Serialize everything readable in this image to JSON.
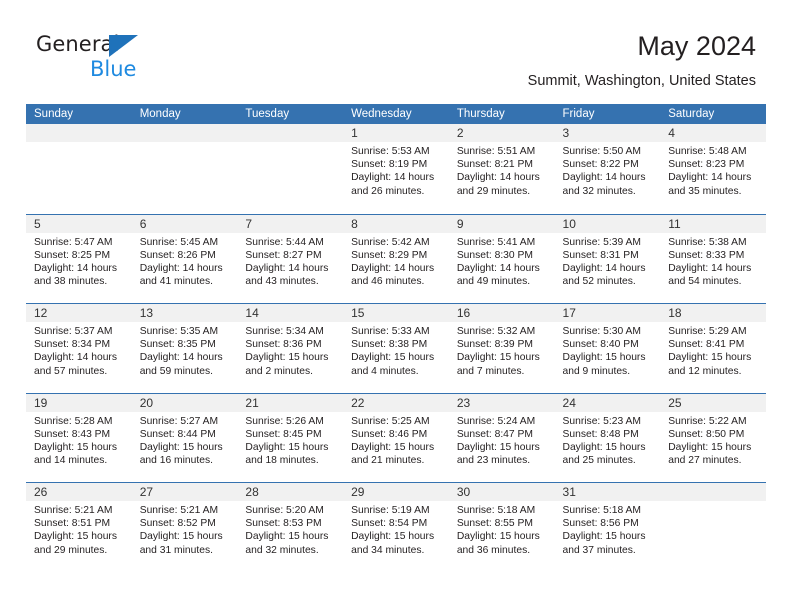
{
  "brand": {
    "name_part1": "General",
    "name_part2": "Blue",
    "accent_color": "#1f8ae0",
    "triangle_color": "#1f72ba"
  },
  "header": {
    "title": "May 2024",
    "subtitle": "Summit, Washington, United States"
  },
  "calendar": {
    "header_bg": "#3572b0",
    "day_band_bg": "#f1f1f1",
    "weekdays": [
      "Sunday",
      "Monday",
      "Tuesday",
      "Wednesday",
      "Thursday",
      "Friday",
      "Saturday"
    ],
    "weeks": [
      [
        {
          "day": "",
          "lines": []
        },
        {
          "day": "",
          "lines": []
        },
        {
          "day": "",
          "lines": []
        },
        {
          "day": "1",
          "lines": [
            "Sunrise: 5:53 AM",
            "Sunset: 8:19 PM",
            "Daylight: 14 hours",
            "and 26 minutes."
          ]
        },
        {
          "day": "2",
          "lines": [
            "Sunrise: 5:51 AM",
            "Sunset: 8:21 PM",
            "Daylight: 14 hours",
            "and 29 minutes."
          ]
        },
        {
          "day": "3",
          "lines": [
            "Sunrise: 5:50 AM",
            "Sunset: 8:22 PM",
            "Daylight: 14 hours",
            "and 32 minutes."
          ]
        },
        {
          "day": "4",
          "lines": [
            "Sunrise: 5:48 AM",
            "Sunset: 8:23 PM",
            "Daylight: 14 hours",
            "and 35 minutes."
          ]
        }
      ],
      [
        {
          "day": "5",
          "lines": [
            "Sunrise: 5:47 AM",
            "Sunset: 8:25 PM",
            "Daylight: 14 hours",
            "and 38 minutes."
          ]
        },
        {
          "day": "6",
          "lines": [
            "Sunrise: 5:45 AM",
            "Sunset: 8:26 PM",
            "Daylight: 14 hours",
            "and 41 minutes."
          ]
        },
        {
          "day": "7",
          "lines": [
            "Sunrise: 5:44 AM",
            "Sunset: 8:27 PM",
            "Daylight: 14 hours",
            "and 43 minutes."
          ]
        },
        {
          "day": "8",
          "lines": [
            "Sunrise: 5:42 AM",
            "Sunset: 8:29 PM",
            "Daylight: 14 hours",
            "and 46 minutes."
          ]
        },
        {
          "day": "9",
          "lines": [
            "Sunrise: 5:41 AM",
            "Sunset: 8:30 PM",
            "Daylight: 14 hours",
            "and 49 minutes."
          ]
        },
        {
          "day": "10",
          "lines": [
            "Sunrise: 5:39 AM",
            "Sunset: 8:31 PM",
            "Daylight: 14 hours",
            "and 52 minutes."
          ]
        },
        {
          "day": "11",
          "lines": [
            "Sunrise: 5:38 AM",
            "Sunset: 8:33 PM",
            "Daylight: 14 hours",
            "and 54 minutes."
          ]
        }
      ],
      [
        {
          "day": "12",
          "lines": [
            "Sunrise: 5:37 AM",
            "Sunset: 8:34 PM",
            "Daylight: 14 hours",
            "and 57 minutes."
          ]
        },
        {
          "day": "13",
          "lines": [
            "Sunrise: 5:35 AM",
            "Sunset: 8:35 PM",
            "Daylight: 14 hours",
            "and 59 minutes."
          ]
        },
        {
          "day": "14",
          "lines": [
            "Sunrise: 5:34 AM",
            "Sunset: 8:36 PM",
            "Daylight: 15 hours",
            "and 2 minutes."
          ]
        },
        {
          "day": "15",
          "lines": [
            "Sunrise: 5:33 AM",
            "Sunset: 8:38 PM",
            "Daylight: 15 hours",
            "and 4 minutes."
          ]
        },
        {
          "day": "16",
          "lines": [
            "Sunrise: 5:32 AM",
            "Sunset: 8:39 PM",
            "Daylight: 15 hours",
            "and 7 minutes."
          ]
        },
        {
          "day": "17",
          "lines": [
            "Sunrise: 5:30 AM",
            "Sunset: 8:40 PM",
            "Daylight: 15 hours",
            "and 9 minutes."
          ]
        },
        {
          "day": "18",
          "lines": [
            "Sunrise: 5:29 AM",
            "Sunset: 8:41 PM",
            "Daylight: 15 hours",
            "and 12 minutes."
          ]
        }
      ],
      [
        {
          "day": "19",
          "lines": [
            "Sunrise: 5:28 AM",
            "Sunset: 8:43 PM",
            "Daylight: 15 hours",
            "and 14 minutes."
          ]
        },
        {
          "day": "20",
          "lines": [
            "Sunrise: 5:27 AM",
            "Sunset: 8:44 PM",
            "Daylight: 15 hours",
            "and 16 minutes."
          ]
        },
        {
          "day": "21",
          "lines": [
            "Sunrise: 5:26 AM",
            "Sunset: 8:45 PM",
            "Daylight: 15 hours",
            "and 18 minutes."
          ]
        },
        {
          "day": "22",
          "lines": [
            "Sunrise: 5:25 AM",
            "Sunset: 8:46 PM",
            "Daylight: 15 hours",
            "and 21 minutes."
          ]
        },
        {
          "day": "23",
          "lines": [
            "Sunrise: 5:24 AM",
            "Sunset: 8:47 PM",
            "Daylight: 15 hours",
            "and 23 minutes."
          ]
        },
        {
          "day": "24",
          "lines": [
            "Sunrise: 5:23 AM",
            "Sunset: 8:48 PM",
            "Daylight: 15 hours",
            "and 25 minutes."
          ]
        },
        {
          "day": "25",
          "lines": [
            "Sunrise: 5:22 AM",
            "Sunset: 8:50 PM",
            "Daylight: 15 hours",
            "and 27 minutes."
          ]
        }
      ],
      [
        {
          "day": "26",
          "lines": [
            "Sunrise: 5:21 AM",
            "Sunset: 8:51 PM",
            "Daylight: 15 hours",
            "and 29 minutes."
          ]
        },
        {
          "day": "27",
          "lines": [
            "Sunrise: 5:21 AM",
            "Sunset: 8:52 PM",
            "Daylight: 15 hours",
            "and 31 minutes."
          ]
        },
        {
          "day": "28",
          "lines": [
            "Sunrise: 5:20 AM",
            "Sunset: 8:53 PM",
            "Daylight: 15 hours",
            "and 32 minutes."
          ]
        },
        {
          "day": "29",
          "lines": [
            "Sunrise: 5:19 AM",
            "Sunset: 8:54 PM",
            "Daylight: 15 hours",
            "and 34 minutes."
          ]
        },
        {
          "day": "30",
          "lines": [
            "Sunrise: 5:18 AM",
            "Sunset: 8:55 PM",
            "Daylight: 15 hours",
            "and 36 minutes."
          ]
        },
        {
          "day": "31",
          "lines": [
            "Sunrise: 5:18 AM",
            "Sunset: 8:56 PM",
            "Daylight: 15 hours",
            "and 37 minutes."
          ]
        },
        {
          "day": "",
          "lines": []
        }
      ]
    ]
  }
}
